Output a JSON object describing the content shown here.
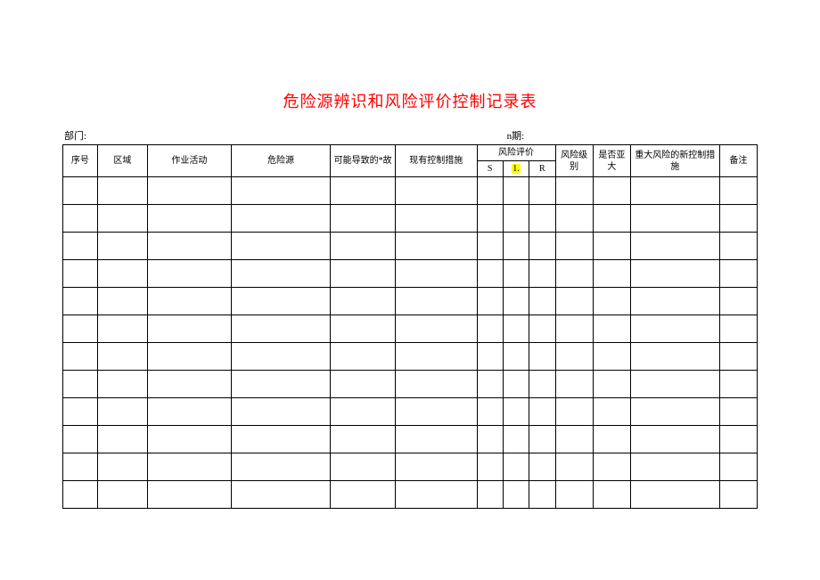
{
  "title": "危险源辨识和风险评价控制记录表",
  "meta": {
    "department_label": "部门:",
    "date_label_prefix": "n",
    "date_label_suffix": "期:"
  },
  "headers": {
    "seq": "序号",
    "area": "区域",
    "activity": "作业活动",
    "hazard": "危险源",
    "accident": "可能导致的*故",
    "measure": "现有控制措施",
    "eval_group": "风险评价",
    "eval_s": "S",
    "eval_l": "1.",
    "eval_r": "R",
    "level": "风险级别",
    "major": "是否亚大",
    "newmeasure": "重大风险的新控制措施",
    "remark": "备注"
  },
  "row_count": 12
}
